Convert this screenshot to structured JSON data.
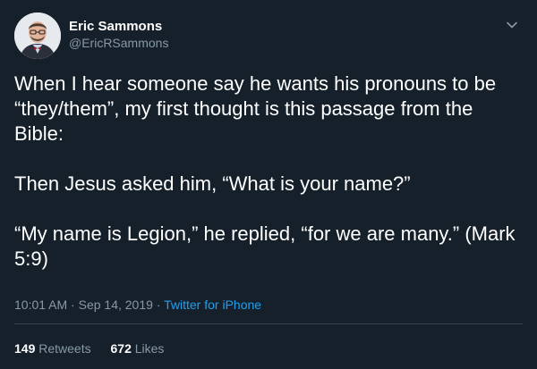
{
  "author": {
    "display_name": "Eric Sammons",
    "handle": "@EricRSammons"
  },
  "tweet": {
    "paragraphs": [
      "When I hear someone say he wants his pronouns to be “they/them”, my first thought is this passage from the Bible:",
      "Then Jesus asked him, “What is your name?”",
      "“My name is Legion,” he replied, “for we are many.” (Mark 5:9)"
    ],
    "time": "10:01 AM",
    "separator": " · ",
    "date": "Sep 14, 2019",
    "source": "Twitter for iPhone"
  },
  "stats": {
    "retweets_count": "149",
    "retweets_label": "Retweets",
    "likes_count": "672",
    "likes_label": "Likes"
  },
  "icons": {
    "menu": "chevron-down-icon",
    "avatar": "avatar"
  },
  "colors": {
    "background": "#15202b",
    "text": "#ffffff",
    "secondary": "#8899a6",
    "link": "#1da1f2",
    "divider": "#38444d"
  }
}
